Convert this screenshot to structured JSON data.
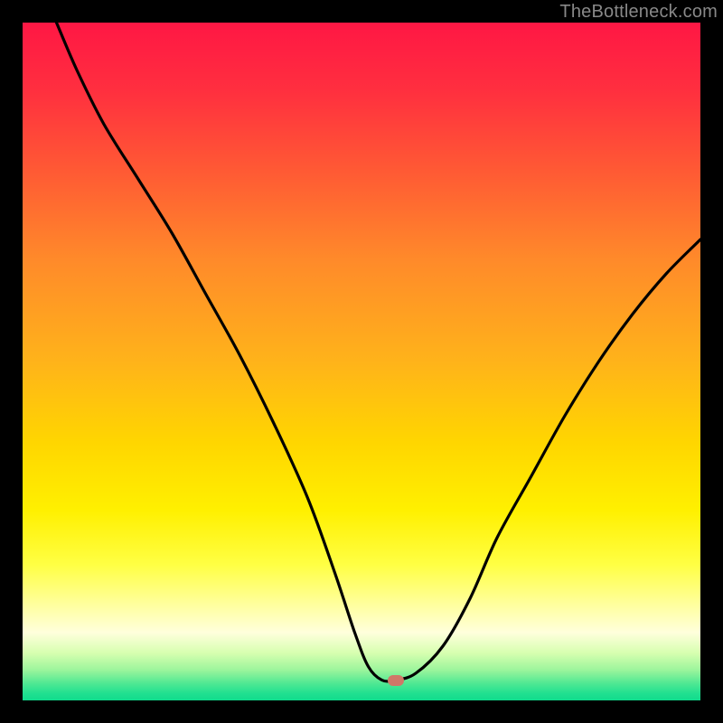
{
  "watermark": "TheBottleneck.com",
  "colors": {
    "black": "#000000",
    "curve": "#000000",
    "marker": "#d07868"
  },
  "gradient_stops": [
    {
      "offset": 0.0,
      "color": "#ff1744"
    },
    {
      "offset": 0.1,
      "color": "#ff2f3f"
    },
    {
      "offset": 0.22,
      "color": "#ff5a34"
    },
    {
      "offset": 0.35,
      "color": "#ff8a2a"
    },
    {
      "offset": 0.5,
      "color": "#ffb31a"
    },
    {
      "offset": 0.62,
      "color": "#ffd600"
    },
    {
      "offset": 0.72,
      "color": "#fff000"
    },
    {
      "offset": 0.8,
      "color": "#ffff44"
    },
    {
      "offset": 0.86,
      "color": "#ffffa0"
    },
    {
      "offset": 0.9,
      "color": "#ffffdc"
    },
    {
      "offset": 0.93,
      "color": "#d7ffb0"
    },
    {
      "offset": 0.955,
      "color": "#9cf59c"
    },
    {
      "offset": 0.975,
      "color": "#4fe893"
    },
    {
      "offset": 0.99,
      "color": "#20e090"
    },
    {
      "offset": 1.0,
      "color": "#10db8c"
    }
  ],
  "chart_data": {
    "type": "line",
    "title": "",
    "xlabel": "",
    "ylabel": "",
    "xlim": [
      0,
      100
    ],
    "ylim": [
      0,
      100
    ],
    "grid": false,
    "legend": false,
    "series": [
      {
        "name": "bottleneck-curve",
        "x": [
          5,
          8,
          12,
          17,
          22,
          27,
          32,
          37,
          42,
          46,
          49,
          51,
          53,
          55,
          58,
          62,
          66,
          70,
          75,
          80,
          85,
          90,
          95,
          100
        ],
        "y": [
          100,
          93,
          85,
          77,
          69,
          60,
          51,
          41,
          30,
          19,
          10,
          5,
          3,
          3,
          4,
          8,
          15,
          24,
          33,
          42,
          50,
          57,
          63,
          68
        ]
      }
    ],
    "marker": {
      "x": 55,
      "y": 3
    }
  }
}
